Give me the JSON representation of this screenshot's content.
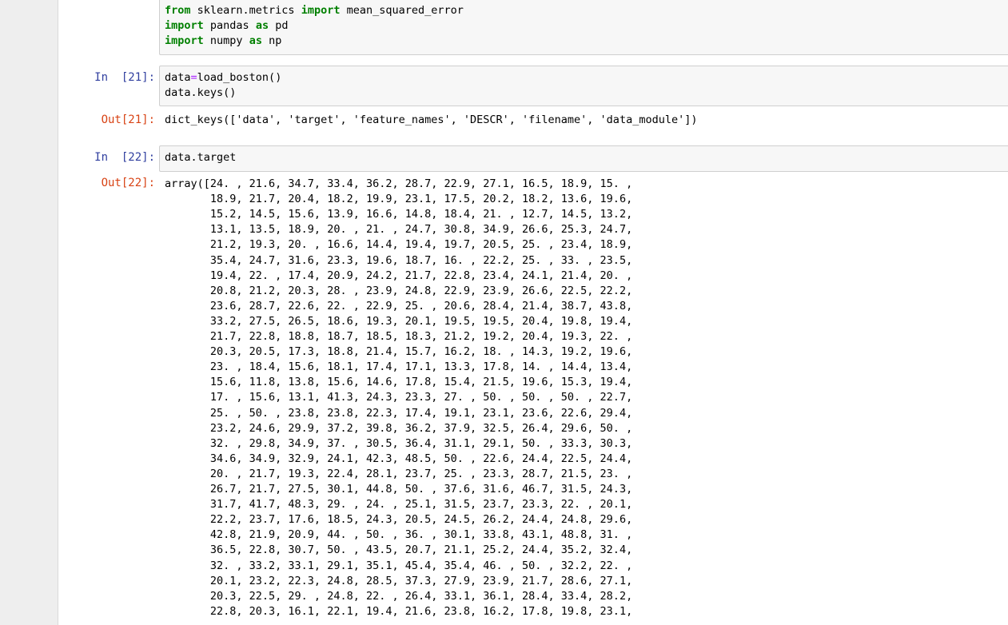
{
  "cells": {
    "imports": {
      "lines": [
        [
          {
            "t": "from",
            "kw": true
          },
          {
            "t": " sklearn.metrics "
          },
          {
            "t": "import",
            "kw": true
          },
          {
            "t": " mean_squared_error"
          }
        ],
        [
          {
            "t": "import",
            "kw": true
          },
          {
            "t": " pandas "
          },
          {
            "t": "as",
            "kw": true
          },
          {
            "t": " pd"
          }
        ],
        [
          {
            "t": "import",
            "kw": true
          },
          {
            "t": " numpy "
          },
          {
            "t": "as",
            "kw": true
          },
          {
            "t": " np"
          }
        ]
      ]
    },
    "cell21": {
      "in_prompt": "In  [21]:",
      "code_line1_a": "data",
      "code_line1_op": "=",
      "code_line1_b": "load_boston()",
      "code_line2": "data.keys()",
      "out_prompt": "Out[21]:",
      "output": "dict_keys(['data', 'target', 'feature_names', 'DESCR', 'filename', 'data_module'])"
    },
    "cell22": {
      "in_prompt": "In  [22]:",
      "code_line1": "data.target",
      "out_prompt": "Out[22]:",
      "output_lines": [
        "array([24. , 21.6, 34.7, 33.4, 36.2, 28.7, 22.9, 27.1, 16.5, 18.9, 15. ,",
        "       18.9, 21.7, 20.4, 18.2, 19.9, 23.1, 17.5, 20.2, 18.2, 13.6, 19.6,",
        "       15.2, 14.5, 15.6, 13.9, 16.6, 14.8, 18.4, 21. , 12.7, 14.5, 13.2,",
        "       13.1, 13.5, 18.9, 20. , 21. , 24.7, 30.8, 34.9, 26.6, 25.3, 24.7,",
        "       21.2, 19.3, 20. , 16.6, 14.4, 19.4, 19.7, 20.5, 25. , 23.4, 18.9,",
        "       35.4, 24.7, 31.6, 23.3, 19.6, 18.7, 16. , 22.2, 25. , 33. , 23.5,",
        "       19.4, 22. , 17.4, 20.9, 24.2, 21.7, 22.8, 23.4, 24.1, 21.4, 20. ,",
        "       20.8, 21.2, 20.3, 28. , 23.9, 24.8, 22.9, 23.9, 26.6, 22.5, 22.2,",
        "       23.6, 28.7, 22.6, 22. , 22.9, 25. , 20.6, 28.4, 21.4, 38.7, 43.8,",
        "       33.2, 27.5, 26.5, 18.6, 19.3, 20.1, 19.5, 19.5, 20.4, 19.8, 19.4,",
        "       21.7, 22.8, 18.8, 18.7, 18.5, 18.3, 21.2, 19.2, 20.4, 19.3, 22. ,",
        "       20.3, 20.5, 17.3, 18.8, 21.4, 15.7, 16.2, 18. , 14.3, 19.2, 19.6,",
        "       23. , 18.4, 15.6, 18.1, 17.4, 17.1, 13.3, 17.8, 14. , 14.4, 13.4,",
        "       15.6, 11.8, 13.8, 15.6, 14.6, 17.8, 15.4, 21.5, 19.6, 15.3, 19.4,",
        "       17. , 15.6, 13.1, 41.3, 24.3, 23.3, 27. , 50. , 50. , 50. , 22.7,",
        "       25. , 50. , 23.8, 23.8, 22.3, 17.4, 19.1, 23.1, 23.6, 22.6, 29.4,",
        "       23.2, 24.6, 29.9, 37.2, 39.8, 36.2, 37.9, 32.5, 26.4, 29.6, 50. ,",
        "       32. , 29.8, 34.9, 37. , 30.5, 36.4, 31.1, 29.1, 50. , 33.3, 30.3,",
        "       34.6, 34.9, 32.9, 24.1, 42.3, 48.5, 50. , 22.6, 24.4, 22.5, 24.4,",
        "       20. , 21.7, 19.3, 22.4, 28.1, 23.7, 25. , 23.3, 28.7, 21.5, 23. ,",
        "       26.7, 21.7, 27.5, 30.1, 44.8, 50. , 37.6, 31.6, 46.7, 31.5, 24.3,",
        "       31.7, 41.7, 48.3, 29. , 24. , 25.1, 31.5, 23.7, 23.3, 22. , 20.1,",
        "       22.2, 23.7, 17.6, 18.5, 24.3, 20.5, 24.5, 26.2, 24.4, 24.8, 29.6,",
        "       42.8, 21.9, 20.9, 44. , 50. , 36. , 30.1, 33.8, 43.1, 48.8, 31. ,",
        "       36.5, 22.8, 30.7, 50. , 43.5, 20.7, 21.1, 25.2, 24.4, 35.2, 32.4,",
        "       32. , 33.2, 33.1, 29.1, 35.1, 45.4, 35.4, 46. , 50. , 32.2, 22. ,",
        "       20.1, 23.2, 22.3, 24.8, 28.5, 37.3, 27.9, 23.9, 21.7, 28.6, 27.1,",
        "       20.3, 22.5, 29. , 24.8, 22. , 26.4, 33.1, 36.1, 28.4, 33.4, 28.2,",
        "       22.8, 20.3, 16.1, 22.1, 19.4, 21.6, 23.8, 16.2, 17.8, 19.8, 23.1,"
      ]
    }
  }
}
